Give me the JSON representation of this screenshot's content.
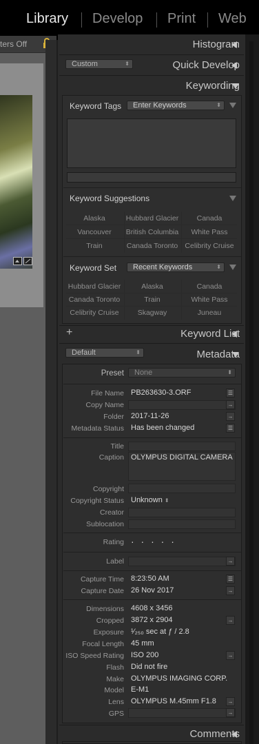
{
  "modules": {
    "library": "Library",
    "develop": "Develop",
    "print": "Print",
    "web": "Web"
  },
  "filter": {
    "label": "ters Off"
  },
  "panels": {
    "histogram": "Histogram",
    "quick_develop": "Quick Develop",
    "quick_develop_preset": "Custom",
    "keywording": "Keywording",
    "keyword_list": "Keyword List",
    "keyword_list_add": "+",
    "metadata": "Metadata",
    "metadata_preset": "Default",
    "comments": "Comments"
  },
  "keywording": {
    "tags_label": "Keyword Tags",
    "tags_mode": "Enter Keywords",
    "suggestions_label": "Keyword Suggestions",
    "suggestions": [
      "Alaska",
      "Hubbard Glacier",
      "Canada",
      "Vancouver",
      "British Columbia",
      "White Pass",
      "Train",
      "Canada Toronto",
      "Celibrity Cruise"
    ],
    "set_label": "Keyword Set",
    "set_value": "Recent Keywords",
    "set_items": [
      "Hubbard Glacier",
      "Alaska",
      "Canada",
      "Canada Toronto",
      "Train",
      "White Pass",
      "Celibrity Cruise",
      "Skagway",
      "Juneau"
    ]
  },
  "metadata": {
    "preset_label": "Preset",
    "preset_value": "None",
    "file_name_label": "File Name",
    "file_name": "PB263630-3.ORF",
    "copy_name_label": "Copy Name",
    "copy_name": "",
    "folder_label": "Folder",
    "folder": "2017-11-26",
    "status_label": "Metadata Status",
    "status": "Has been changed",
    "title_label": "Title",
    "caption_label": "Caption",
    "caption": "OLYMPUS DIGITAL CAMERA",
    "copyright_label": "Copyright",
    "copyright_status_label": "Copyright Status",
    "copyright_status": "Unknown",
    "creator_label": "Creator",
    "sublocation_label": "Sublocation",
    "rating_label": "Rating",
    "rating": "· · · · ·",
    "label_label": "Label",
    "capture_time_label": "Capture Time",
    "capture_time": "8:23:50 AM",
    "capture_date_label": "Capture Date",
    "capture_date": "26 Nov 2017",
    "dimensions_label": "Dimensions",
    "dimensions": "4608 x 3456",
    "cropped_label": "Cropped",
    "cropped": "3872 x 2904",
    "exposure_label": "Exposure",
    "exposure": "¹⁄₂₅₀ sec at ƒ / 2.8",
    "focal_label": "Focal Length",
    "focal": "45 mm",
    "iso_label": "ISO Speed Rating",
    "iso": "ISO 200",
    "flash_label": "Flash",
    "flash": "Did not fire",
    "make_label": "Make",
    "make": "OLYMPUS IMAGING CORP.",
    "model_label": "Model",
    "model": "E-M1",
    "lens_label": "Lens",
    "lens": "OLYMPUS M.45mm F1.8",
    "gps_label": "GPS"
  }
}
